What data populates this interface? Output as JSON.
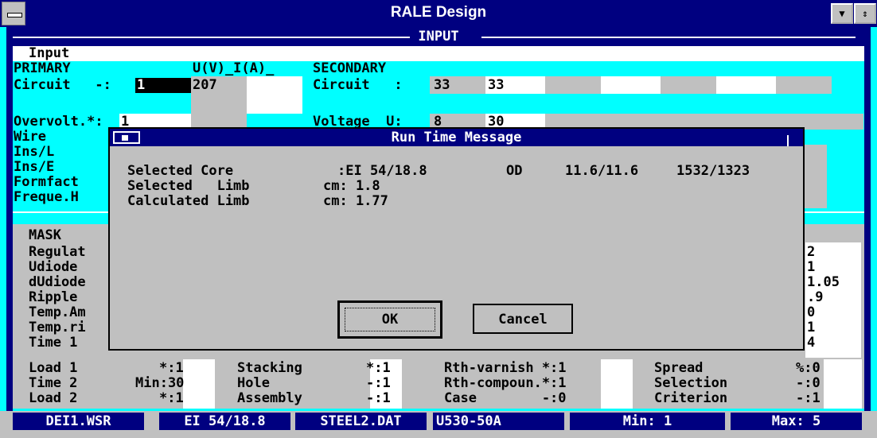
{
  "window": {
    "title": "RALE Design",
    "inner_title": "INPUT",
    "subtitle": "Input"
  },
  "colors": {
    "navy": "#000080",
    "cyan": "#00ffff",
    "gray": "#c0c0c0",
    "white": "#ffffff"
  },
  "icons": {
    "system_menu": "minus-bar",
    "scroll": "arrow-down",
    "restore": "arrow-up-down"
  },
  "top": {
    "primary_header": "PRIMARY",
    "uia_header": "U(V)_I(A)_",
    "secondary_header": "SECONDARY",
    "circuit_label": "Circuit   -:",
    "circuit_value": "1",
    "circuit_voltage": "207",
    "sec_circuit_label": "Circuit   :",
    "sec_circuit_value": "33",
    "sec_circuit_col2": "33",
    "overvolt_label": "Overvolt.*:",
    "overvolt_value": "1",
    "voltage_label": "Voltage  U:",
    "voltage_value": "8",
    "voltage_col2": "30",
    "wire": "Wire",
    "ins_l": "Ins/L",
    "ins_e": "Ins/E",
    "formfact": "Formfact",
    "freque": "Freque.H"
  },
  "mask": {
    "header": "MASK",
    "left_labels": [
      "Regulat",
      "Udiode",
      "dUdiode",
      "Ripple",
      "Temp.Am",
      "Temp.ri",
      "Time 1"
    ],
    "right_values": [
      "2",
      "1",
      "1.05",
      ".9",
      "0",
      "1",
      "4"
    ]
  },
  "bottom_rows": [
    {
      "c1": "Load 1",
      "v1": "*:1",
      "c2": "Stacking",
      "v2": "*:1",
      "c3": "Rth-varnish *:1",
      "c4": "Spread",
      "v4": "%:0"
    },
    {
      "c1": "Time 2",
      "v1": "Min:30",
      "c2": "Hole",
      "v2": "-:1",
      "c3": "Rth-compoun.*:1",
      "c4": "Selection",
      "v4": "-:0"
    },
    {
      "c1": "Load 2",
      "v1": "*:1",
      "c2": "Assembly",
      "v2": "-:1",
      "c3": "Case        -:0",
      "c4": "Criterion",
      "v4": "-:1"
    }
  ],
  "dialog": {
    "title": "Run Time Message",
    "line1": {
      "label": "Selected Core",
      "value": ":EI 54/18.8",
      "od": "OD",
      "od_value": "11.6/11.6",
      "extra": "1532/1323"
    },
    "line2": {
      "label": "Selected   Limb",
      "value": "cm: 1.8"
    },
    "line3": {
      "label": "Calculated Limb",
      "value": "cm: 1.77"
    },
    "ok_label": "OK",
    "cancel_label": "Cancel"
  },
  "status": [
    "DEI1.WSR",
    "EI 54/18.8",
    "STEEL2.DAT",
    "U530-50A",
    "Min: 1",
    "Max: 5"
  ]
}
